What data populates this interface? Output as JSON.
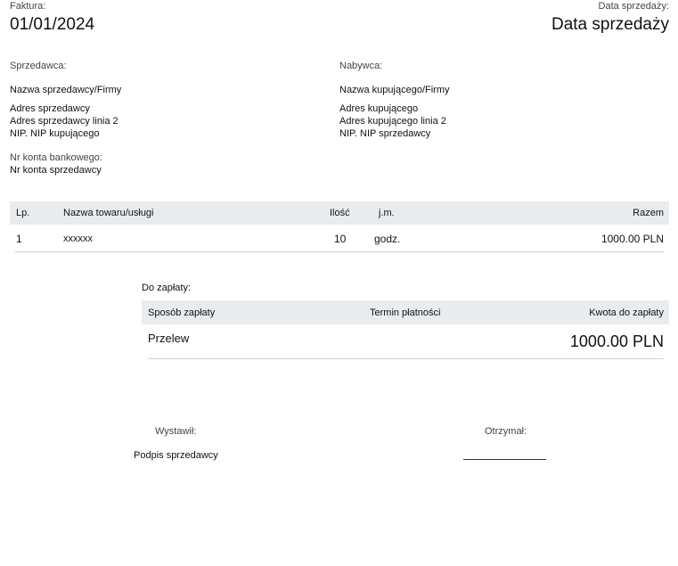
{
  "invoice": {
    "number_label": "Faktura:",
    "number_value": "01/01/2024",
    "sale_date_label": "Data sprzedaży:",
    "sale_date_value": "Data sprzedaży"
  },
  "seller": {
    "heading": "Sprzedawca:",
    "name": "Nazwa sprzedawcy/Firmy",
    "address_line1": "Adres sprzedawcy",
    "address_line2": "Adres sprzedawcy linia 2",
    "nip": "NIP. NIP kupującego",
    "bank_label": "Nr konta bankowego:",
    "bank_value": "Nr konta sprzedawcy"
  },
  "buyer": {
    "heading": "Nabywca:",
    "name": "Nazwa kupującego/Firmy",
    "address_line1": "Adres kupującego",
    "address_line2": "Adres kupującego linia 2",
    "nip": "NIP. NIP sprzedawcy"
  },
  "items_table": {
    "headers": {
      "lp": "Lp.",
      "name": "Nazwa towaru/usługi",
      "qty": "Ilość",
      "unit": "j.m.",
      "total": "Razem"
    },
    "rows": [
      {
        "lp": "1",
        "name": "xxxxxx",
        "qty": "10",
        "unit": "godz.",
        "total": "1000.00 PLN"
      }
    ]
  },
  "payment": {
    "heading": "Do zapłaty:",
    "headers": {
      "method": "Sposób zapłaty",
      "due": "Termin płatności",
      "amount": "Kwota do zapłaty"
    },
    "method_value": "Przelew",
    "amount_value": "1000.00 PLN"
  },
  "signatures": {
    "issued_label": "Wystawił:",
    "issued_value": "Podpis sprzedawcy",
    "received_label": "Otrzymał:"
  },
  "colors": {
    "header_band": "#e9ecef",
    "row_line": "#cfcfcf",
    "text": "#111111"
  }
}
